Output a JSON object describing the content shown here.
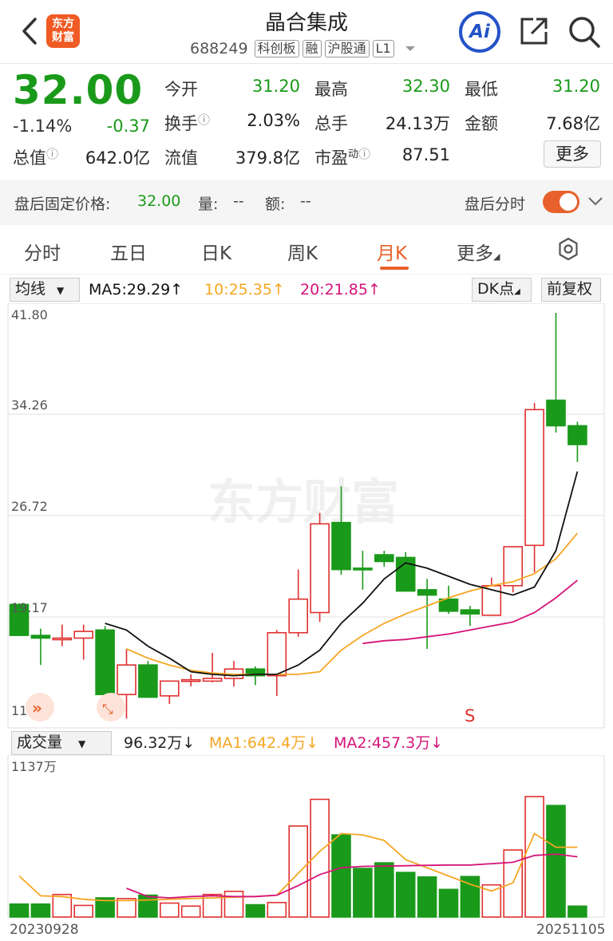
{
  "header": {
    "back": "‹",
    "logo_line1": "东方",
    "logo_line2": "财富",
    "title": "晶合集成",
    "code": "688249",
    "tags": [
      "科创板",
      "融",
      "沪股通",
      "L1"
    ],
    "ai_label": "Ai"
  },
  "quote": {
    "price": "32.00",
    "change_pct": "-1.14%",
    "change": "-0.37",
    "total_value_label": "总值",
    "total_value": "642.0亿",
    "open_label": "今开",
    "open": "31.20",
    "high_label": "最高",
    "high": "32.30",
    "low_label": "最低",
    "low": "31.20",
    "turnover_label": "换手",
    "turnover": "2.03%",
    "volume_label": "总手",
    "volume": "24.13万",
    "amount_label": "金额",
    "amount": "7.68亿",
    "float_label": "流值",
    "float_value": "379.8亿",
    "pe_label": "市盈",
    "pe_sup": "动",
    "pe": "87.51",
    "more_label": "更多"
  },
  "after_hours": {
    "fixed_label": "盘后固定价格:",
    "fixed_price": "32.00",
    "vol_label": "量:",
    "vol": "--",
    "amt_label": "额:",
    "amt": "--",
    "toggle_label": "盘后分时"
  },
  "tabs": [
    "分时",
    "五日",
    "日K",
    "周K",
    "月K",
    "更多"
  ],
  "active_tab": "月K",
  "chart_controls": {
    "ma_selector": "均线",
    "ma5": "MA5:29.29↑",
    "ma10": "10:25.35↑",
    "ma20": "20:21.85↑",
    "dk": "DK点",
    "adjust": "前复权",
    "vol_selector": "成交量",
    "vol_value": "96.32万↓",
    "vol_ma1": "MA1:642.4万↓",
    "vol_ma2": "MA2:457.3万↓",
    "watermark": "东方财富",
    "sell_marker": "S"
  },
  "colors": {
    "up": "#e03030",
    "down": "#1a9a1a",
    "ma5": "#111111",
    "ma10": "#f5a623",
    "ma20": "#d4147a",
    "accent": "#e8602c",
    "brand": "#2453c8"
  },
  "chart_data": {
    "type": "candlestick",
    "price_axis": {
      "ticks": [
        "41.80",
        "34.26",
        "26.72",
        "19.17",
        "11.63"
      ],
      "ylim": [
        11.63,
        41.8
      ]
    },
    "volume_axis": {
      "top_label": "1137万",
      "ylim": [
        0,
        1137
      ]
    },
    "x_start_label": "20230928",
    "x_end_label": "20251105",
    "candles": [
      {
        "o": 20.1,
        "h": 20.2,
        "l": 17.8,
        "c": 17.8
      },
      {
        "o": 17.8,
        "h": 18.3,
        "l": 15.6,
        "c": 17.6
      },
      {
        "o": 17.6,
        "h": 18.6,
        "l": 17.0,
        "c": 17.6
      },
      {
        "o": 17.6,
        "h": 18.6,
        "l": 16.0,
        "c": 18.1
      },
      {
        "o": 18.2,
        "h": 18.5,
        "l": 13.4,
        "c": 13.4
      },
      {
        "o": 13.4,
        "h": 16.8,
        "l": 11.6,
        "c": 15.6
      },
      {
        "o": 15.6,
        "h": 15.9,
        "l": 13.3,
        "c": 13.2
      },
      {
        "o": 13.3,
        "h": 14.4,
        "l": 12.7,
        "c": 14.4
      },
      {
        "o": 14.4,
        "h": 14.9,
        "l": 14.0,
        "c": 14.5
      },
      {
        "o": 14.4,
        "h": 16.5,
        "l": 14.3,
        "c": 14.6
      },
      {
        "o": 14.6,
        "h": 15.9,
        "l": 14.0,
        "c": 15.3
      },
      {
        "o": 15.3,
        "h": 15.5,
        "l": 14.1,
        "c": 14.8
      },
      {
        "o": 14.8,
        "h": 18.2,
        "l": 13.3,
        "c": 18.0
      },
      {
        "o": 18.0,
        "h": 22.7,
        "l": 17.7,
        "c": 20.5
      },
      {
        "o": 19.5,
        "h": 26.9,
        "l": 18.8,
        "c": 26.1
      },
      {
        "o": 26.2,
        "h": 28.9,
        "l": 22.3,
        "c": 22.7
      },
      {
        "o": 22.8,
        "h": 24.1,
        "l": 21.2,
        "c": 22.7
      },
      {
        "o": 23.8,
        "h": 24.1,
        "l": 22.9,
        "c": 23.3
      },
      {
        "o": 23.6,
        "h": 24.0,
        "l": 21.2,
        "c": 21.1
      },
      {
        "o": 21.2,
        "h": 22.0,
        "l": 16.8,
        "c": 20.8
      },
      {
        "o": 20.5,
        "h": 21.5,
        "l": 19.4,
        "c": 19.6
      },
      {
        "o": 19.7,
        "h": 20.0,
        "l": 18.5,
        "c": 19.4
      },
      {
        "o": 19.3,
        "h": 22.1,
        "l": 19.3,
        "c": 21.5
      },
      {
        "o": 21.5,
        "h": 24.4,
        "l": 21.0,
        "c": 24.4
      },
      {
        "o": 24.5,
        "h": 35.1,
        "l": 22.5,
        "c": 34.6
      },
      {
        "o": 35.3,
        "h": 41.8,
        "l": 32.9,
        "c": 33.4
      },
      {
        "o": 33.4,
        "h": 33.7,
        "l": 30.7,
        "c": 32.0
      }
    ],
    "ma5_price": [
      null,
      null,
      null,
      null,
      18.7,
      18.2,
      17.0,
      16.1,
      15.1,
      14.9,
      14.8,
      14.9,
      14.9,
      15.6,
      16.7,
      18.7,
      20.2,
      22.0,
      23.2,
      22.8,
      22.2,
      21.6,
      21.2,
      20.8,
      21.4,
      24.1,
      30.0
    ],
    "ma10_price": [
      null,
      null,
      null,
      null,
      null,
      16.8,
      16.1,
      15.6,
      15.2,
      15.0,
      14.9,
      14.9,
      14.9,
      14.9,
      15.1,
      16.7,
      17.8,
      18.7,
      19.4,
      20.0,
      20.6,
      21.1,
      21.5,
      21.8,
      22.4,
      23.5,
      25.4
    ],
    "ma20_price": [
      null,
      null,
      null,
      null,
      null,
      null,
      null,
      null,
      null,
      null,
      null,
      null,
      null,
      null,
      null,
      null,
      17.2,
      17.4,
      17.5,
      17.7,
      17.9,
      18.2,
      18.5,
      18.8,
      19.5,
      20.6,
      21.9
    ],
    "volume": [
      95,
      95,
      165,
      85,
      140,
      135,
      160,
      102,
      80,
      165,
      188,
      90,
      106,
      665,
      860,
      600,
      355,
      396,
      326,
      293,
      202,
      296,
      235,
      490,
      880,
      815,
      80
    ],
    "ma1_volume": [
      300,
      155,
      150,
      130,
      120,
      120,
      125,
      130,
      135,
      140,
      145,
      150,
      160,
      320,
      480,
      610,
      600,
      560,
      420,
      360,
      300,
      240,
      190,
      250,
      610,
      510,
      510
    ],
    "ma2_volume": [
      null,
      null,
      null,
      null,
      null,
      210,
      150,
      140,
      150,
      155,
      150,
      150,
      160,
      230,
      310,
      360,
      370,
      372,
      375,
      378,
      380,
      380,
      390,
      400,
      450,
      460,
      440
    ]
  }
}
